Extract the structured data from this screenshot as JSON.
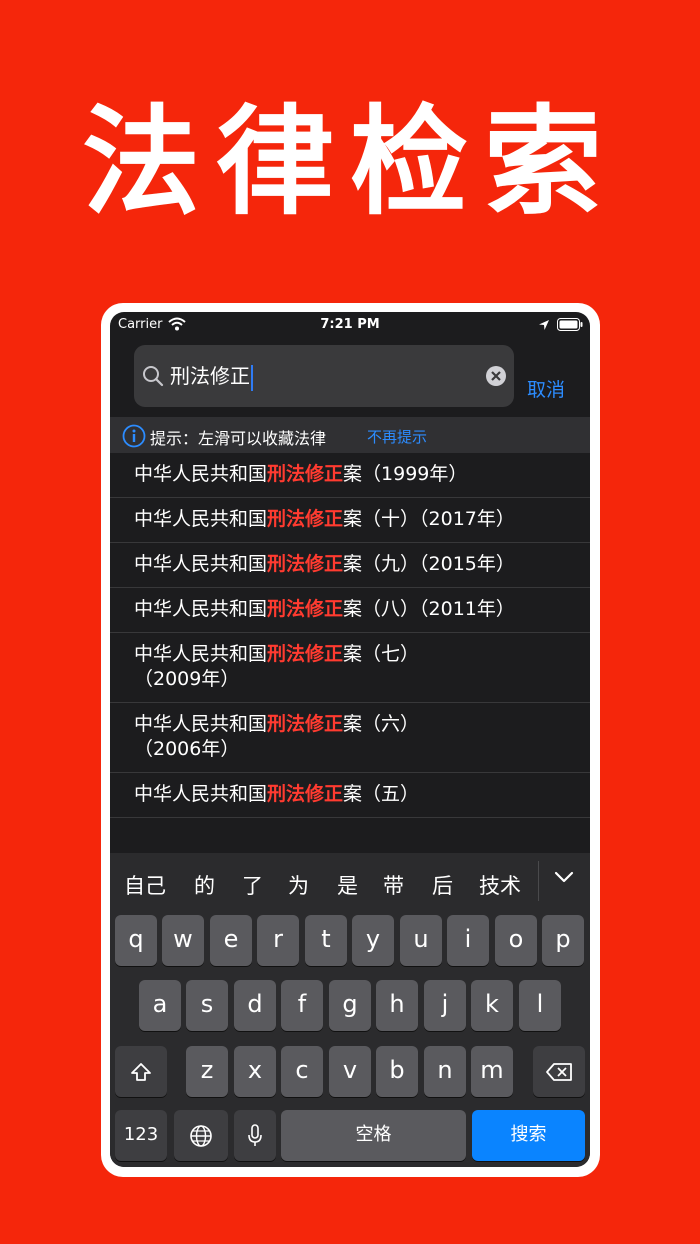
{
  "hero": {
    "title": "法律检索"
  },
  "status_bar": {
    "carrier": "Carrier",
    "time": "7:21 PM"
  },
  "search": {
    "query": "刑法修正",
    "cancel_label": "取消"
  },
  "tip": {
    "text": "提示：左滑可以收藏法律",
    "dismiss_label": "不再提示"
  },
  "results": [
    {
      "prefix": "中华人民共和国",
      "highlight": "刑法修正",
      "suffix": "案（1999年）"
    },
    {
      "prefix": "中华人民共和国",
      "highlight": "刑法修正",
      "suffix": "案（十）（2017年）"
    },
    {
      "prefix": "中华人民共和国",
      "highlight": "刑法修正",
      "suffix": "案（九）（2015年）"
    },
    {
      "prefix": "中华人民共和国",
      "highlight": "刑法修正",
      "suffix": "案（八）（2011年）"
    },
    {
      "prefix": "中华人民共和国",
      "highlight": "刑法修正",
      "suffix": "案（七）（2009年）"
    },
    {
      "prefix": "中华人民共和国",
      "highlight": "刑法修正",
      "suffix": "案（六）（2006年）"
    },
    {
      "prefix": "中华人民共和国",
      "highlight": "刑法修正",
      "suffix": "案（五）"
    }
  ],
  "keyboard": {
    "candidates": [
      "自己",
      "的",
      "了",
      "为",
      "是",
      "带",
      "后",
      "技术"
    ],
    "row1": [
      "q",
      "w",
      "e",
      "r",
      "t",
      "y",
      "u",
      "i",
      "o",
      "p"
    ],
    "row2": [
      "a",
      "s",
      "d",
      "f",
      "g",
      "h",
      "j",
      "k",
      "l"
    ],
    "row3": [
      "z",
      "x",
      "c",
      "v",
      "b",
      "n",
      "m"
    ],
    "numbers_label": "123",
    "space_label": "空格",
    "search_label": "搜索"
  },
  "colors": {
    "background": "#f5260b",
    "highlight": "#ff3b30",
    "accent": "#2c8cff"
  }
}
